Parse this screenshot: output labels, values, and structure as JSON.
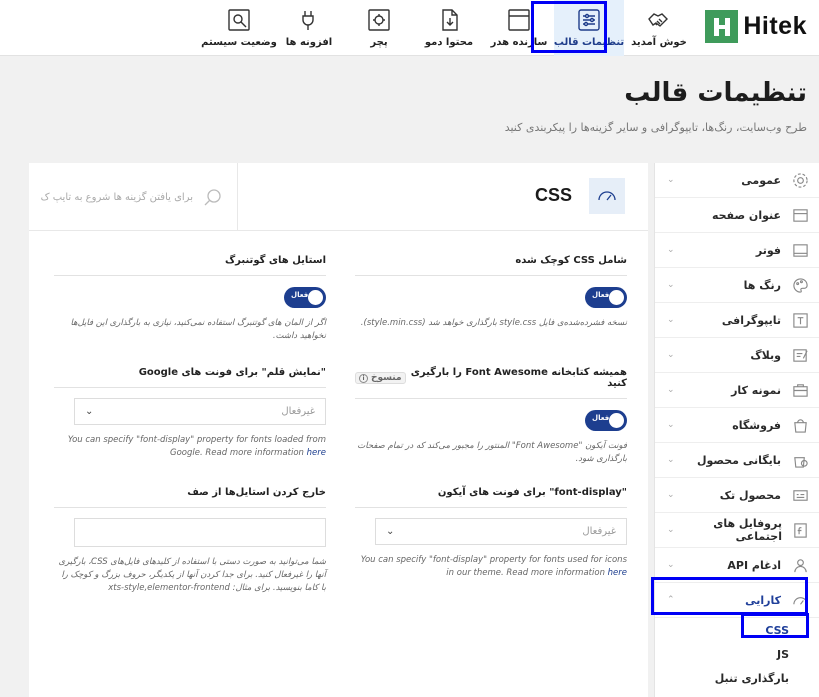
{
  "brand": {
    "name": "Hitek",
    "color": "#3f9b5b"
  },
  "accent": "#1d3e8f",
  "topnav": [
    {
      "label": "خوش آمدید",
      "icon": "handshake-icon",
      "active": false
    },
    {
      "label": "تنظیمات قالب",
      "icon": "sliders-icon",
      "active": true
    },
    {
      "label": "سازنده هدر",
      "icon": "header-builder-icon",
      "active": false
    },
    {
      "label": "محتوا دمو",
      "icon": "demo-content-icon",
      "active": false
    },
    {
      "label": "پچر",
      "icon": "patcher-icon",
      "active": false
    },
    {
      "label": "افزونه ها",
      "icon": "plugin-icon",
      "active": false
    },
    {
      "label": "وضعیت سیستم",
      "icon": "system-status-icon",
      "active": false
    }
  ],
  "page": {
    "title": "تنظیمات قالب",
    "subtitle": "طرح وب‌سایت، رنگ‌ها، تایپوگرافی و سایر گزینه‌ها را پیکربندی کنید"
  },
  "sidebar": {
    "items": [
      {
        "label": "عمومی",
        "icon": "gear-icon",
        "chevron": true
      },
      {
        "label": "عنوان صفحه",
        "icon": "page-title-icon",
        "chevron": false
      },
      {
        "label": "فوتر",
        "icon": "footer-icon",
        "chevron": true
      },
      {
        "label": "رنگ ها",
        "icon": "palette-icon",
        "chevron": true
      },
      {
        "label": "تایپوگرافی",
        "icon": "typography-icon",
        "chevron": true
      },
      {
        "label": "وبلاگ",
        "icon": "blog-icon",
        "chevron": true
      },
      {
        "label": "نمونه کار",
        "icon": "portfolio-icon",
        "chevron": true
      },
      {
        "label": "فروشگاه",
        "icon": "shop-bag-icon",
        "chevron": true
      },
      {
        "label": "بایگانی محصول",
        "icon": "product-archive-icon",
        "chevron": true
      },
      {
        "label": "محصول تک",
        "icon": "single-product-icon",
        "chevron": true
      },
      {
        "label": "پروفایل های اجتماعی",
        "icon": "social-icon",
        "chevron": true
      },
      {
        "label": "ادغام API",
        "icon": "api-icon",
        "chevron": true
      }
    ],
    "open_item": {
      "label": "کارایی",
      "icon": "performance-gauge-icon"
    },
    "sub_items": [
      "CSS",
      "JS",
      "بارگذاری تنبل"
    ]
  },
  "section": {
    "title": "CSS",
    "search_placeholder": "برای یافتن گزینه ها شروع به تایپ ک"
  },
  "options": {
    "minified_css": {
      "title": "شامل CSS کوچک شده",
      "toggle_label": "فعال",
      "desc": "نسخه فشرده‌شده‌ی فایل style.css بارگذاری خواهد شد (style.min.css)."
    },
    "gutenberg_styles": {
      "title": "استایل های گوتنبرگ",
      "toggle_label": "فعال",
      "desc": "اگر از المان های گوتنبرگ استفاده نمی‌کنید، نیازی به بارگذاری این فایل‌ها نخواهید داشت."
    },
    "font_awesome": {
      "title": "همیشه کتابخانه Font Awesome را بارگیری کنید",
      "badge": "منسوخ",
      "toggle_label": "فعال",
      "desc": "فونت آیکون \"Font Awesome\" المنتور را مجبور می‌کند که در تمام صفحات بارگذاری شود."
    },
    "google_font_display": {
      "title": "\"نمایش قلم\" برای فونت های Google",
      "value": "غیرفعال",
      "desc": "You can specify \"font-display\" property for fonts loaded from Google. Read more information",
      "link": "here"
    },
    "icon_font_display": {
      "title": "\"font-display\" برای فونت های آیکون",
      "value": "غیرفعال",
      "desc": "You can specify \"font-display\" property for fonts used for icons in our theme. Read more information",
      "link": "here"
    },
    "exclude_styles": {
      "title": "خارج کردن استایل‌ها از صف",
      "value": "",
      "desc": "شما می‌توانید به صورت دستی با استفاده از کلیدهای فایل‌های CSS، بارگیری آنها را غیرفعال کنید. برای جدا کردن آنها از یکدیگر، حروف بزرگ و کوچک را با کاما بنویسید. برای مثال: xts-style,elementor-frontend"
    }
  }
}
